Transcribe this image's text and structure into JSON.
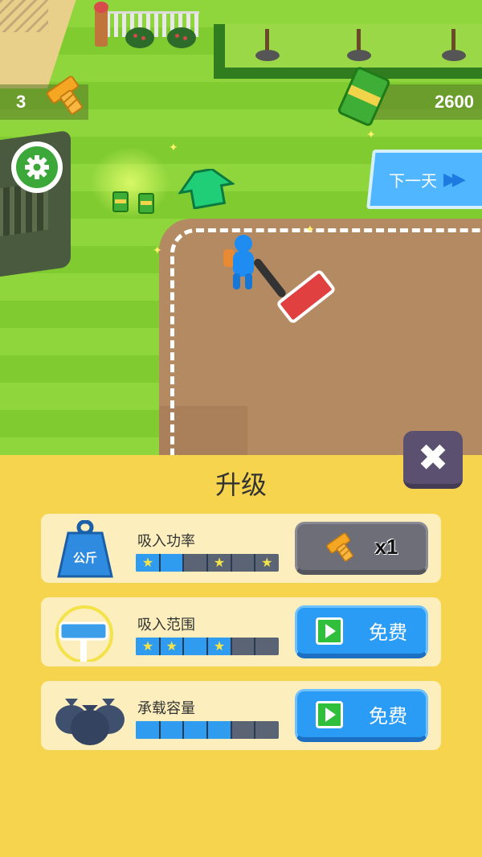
{
  "hud": {
    "bolts_count": "3",
    "cash_amount": "2600",
    "next_day_label": "下一天"
  },
  "upgrade_panel": {
    "title": "升级",
    "close_label": "✖",
    "items": [
      {
        "label": "吸入功率",
        "icon": "weight-kg-icon",
        "icon_text": "公斤",
        "segments_total": 6,
        "segments_filled": 2,
        "stars_at_segments": [
          1,
          4,
          6
        ],
        "button": {
          "type": "bolt",
          "icon": "bolt-icon",
          "text": "x1"
        }
      },
      {
        "label": "吸入范围",
        "icon": "vacuum-head-icon",
        "segments_total": 6,
        "segments_filled": 4,
        "stars_at_segments": [
          1,
          2,
          4
        ],
        "button": {
          "type": "free",
          "icon": "video-play-icon",
          "text": "免费"
        }
      },
      {
        "label": "承载容量",
        "icon": "garbage-bags-icon",
        "segments_total": 6,
        "segments_filled": 4,
        "stars_at_segments": [],
        "button": {
          "type": "free",
          "icon": "video-play-icon",
          "text": "免费"
        }
      }
    ]
  },
  "colors": {
    "panel_bg": "#f7d44e",
    "card_bg": "#fcefbd",
    "progress_fill": "#2f9cf0",
    "free_button": "#2b9cf5",
    "bolt_button": "#6e6e78"
  }
}
